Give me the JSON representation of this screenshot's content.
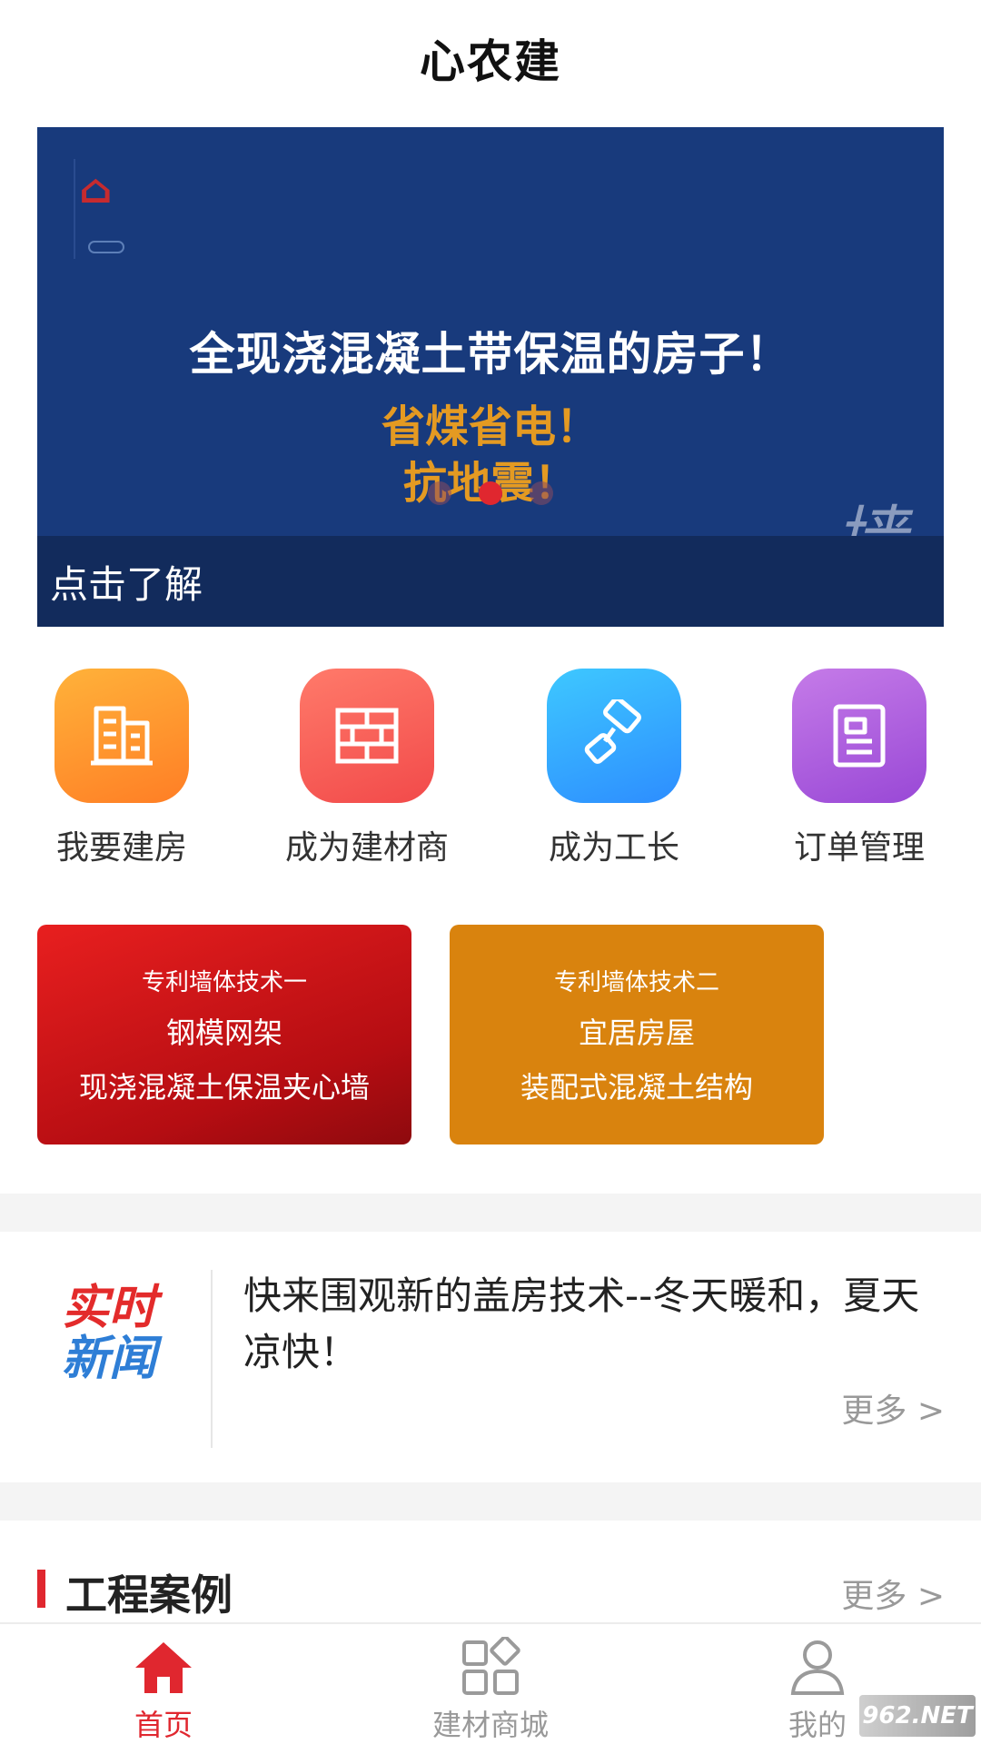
{
  "header": {
    "title": "心农建"
  },
  "banner": {
    "headline": "全现浇混凝土带保温的房子！",
    "sub1": "省煤省电！",
    "sub2": "抗地震！",
    "wall_char": "墙",
    "caption": "点击了解",
    "indicator": {
      "count": 3,
      "active": 2
    }
  },
  "actions": [
    {
      "label": "我要建房",
      "icon": "building-icon"
    },
    {
      "label": "成为建材商",
      "icon": "brick-wall-icon"
    },
    {
      "label": "成为工长",
      "icon": "paint-roller-icon"
    },
    {
      "label": "订单管理",
      "icon": "order-document-icon"
    }
  ],
  "tech_cards": [
    {
      "t1": "专利墙体技术一",
      "t2": "钢模网架",
      "t3": "现浇混凝土保温夹心墙"
    },
    {
      "t1": "专利墙体技术二",
      "t2": "宜居房屋",
      "t3": "装配式混凝土结构"
    }
  ],
  "news": {
    "badge_line1": "实时",
    "badge_line2": "新闻",
    "headline": "快来围观新的盖房技术--冬天暖和，夏天凉快！",
    "more": "更多 >"
  },
  "cases": {
    "title": "工程案例",
    "more": "更多 >"
  },
  "tabbar": {
    "items": [
      {
        "label": "首页",
        "icon": "home-icon",
        "active": true
      },
      {
        "label": "建材商城",
        "icon": "grid-icon",
        "active": false
      },
      {
        "label": "我的",
        "icon": "user-icon",
        "active": false
      }
    ]
  },
  "watermark": "962.NET",
  "colors": {
    "accent": "#e0272f",
    "banner_bg": "#183a7c",
    "orange_text": "#e49a22"
  }
}
